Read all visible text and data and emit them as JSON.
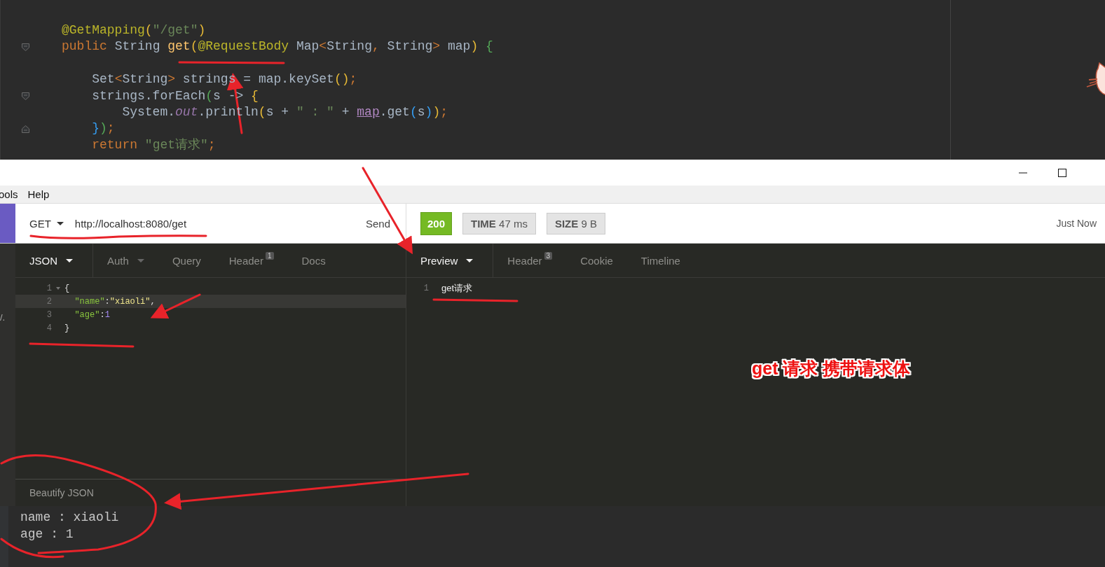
{
  "code_editor": {
    "lines": [
      {
        "kind": "code",
        "tokens": [
          {
            "text": "@GetMapping",
            "kind": "annotation"
          },
          {
            "text": "(",
            "kind": "bracket1"
          },
          {
            "text": "\"/get\"",
            "kind": "string"
          },
          {
            "text": ")",
            "kind": "bracket1"
          }
        ]
      },
      {
        "kind": "fold-start",
        "tokens": [
          {
            "text": "public ",
            "kind": "keyword"
          },
          {
            "text": "String ",
            "kind": "plain"
          },
          {
            "text": "get",
            "kind": "method"
          },
          {
            "text": "(",
            "kind": "bracket1"
          },
          {
            "text": "@RequestBody",
            "kind": "annotation"
          },
          {
            "text": " Map",
            "kind": "plain"
          },
          {
            "text": "<",
            "kind": "keyword"
          },
          {
            "text": "String",
            "kind": "plain"
          },
          {
            "text": ", ",
            "kind": "keyword"
          },
          {
            "text": "String",
            "kind": "plain"
          },
          {
            "text": ">",
            "kind": "keyword"
          },
          {
            "text": " map",
            "kind": "plain"
          },
          {
            "text": ")",
            "kind": "bracket1"
          },
          {
            "text": " {",
            "kind": "bracket2"
          }
        ]
      },
      {
        "kind": "blank"
      },
      {
        "kind": "code",
        "tokens": [
          {
            "text": "    Set",
            "kind": "plain"
          },
          {
            "text": "<",
            "kind": "keyword"
          },
          {
            "text": "String",
            "kind": "plain"
          },
          {
            "text": ">",
            "kind": "keyword"
          },
          {
            "text": " strings = map.keySet",
            "kind": "plain"
          },
          {
            "text": "()",
            "kind": "bracket1"
          },
          {
            "text": ";",
            "kind": "keyword"
          }
        ]
      },
      {
        "kind": "fold-start",
        "tokens": [
          {
            "text": "    strings.forEach",
            "kind": "plain"
          },
          {
            "text": "(",
            "kind": "bracket2"
          },
          {
            "text": "s -> ",
            "kind": "plain"
          },
          {
            "text": "{",
            "kind": "bracket1"
          }
        ]
      },
      {
        "kind": "code",
        "tokens": [
          {
            "text": "        System.",
            "kind": "plain"
          },
          {
            "text": "out",
            "kind": "field"
          },
          {
            "text": ".println",
            "kind": "plain"
          },
          {
            "text": "(",
            "kind": "bracket1"
          },
          {
            "text": "s + ",
            "kind": "plain"
          },
          {
            "text": "\" : \"",
            "kind": "string"
          },
          {
            "text": " + ",
            "kind": "plain"
          },
          {
            "text": "map",
            "kind": "link"
          },
          {
            "text": ".get",
            "kind": "plain"
          },
          {
            "text": "(",
            "kind": "bracket3"
          },
          {
            "text": "s",
            "kind": "plain"
          },
          {
            "text": ")",
            "kind": "bracket3"
          },
          {
            "text": ")",
            "kind": "bracket1"
          },
          {
            "text": ";",
            "kind": "keyword"
          }
        ]
      },
      {
        "kind": "fold-end",
        "tokens": [
          {
            "text": "    }",
            "kind": "bracket3"
          },
          {
            "text": ")",
            "kind": "bracket2"
          },
          {
            "text": ";",
            "kind": "keyword"
          }
        ]
      },
      {
        "kind": "code",
        "tokens": [
          {
            "text": "    return ",
            "kind": "keyword"
          },
          {
            "text": "\"get请求\"",
            "kind": "string"
          },
          {
            "text": ";",
            "kind": "keyword"
          }
        ]
      }
    ]
  },
  "menu_bar": {
    "items": [
      "ools",
      "Help"
    ]
  },
  "request": {
    "method": "GET",
    "url": "http://localhost:8080/get",
    "send": "Send"
  },
  "response": {
    "status": "200",
    "time_label": "TIME",
    "time": "47 ms",
    "size_label": "SIZE",
    "size": "9 B",
    "when": "Just Now"
  },
  "request_tabs": [
    {
      "label": "JSON",
      "dropdown": true,
      "selected": true
    },
    {
      "label": "Auth",
      "dropdown": true,
      "selected": false
    },
    {
      "label": "Query",
      "dropdown": false,
      "selected": false
    },
    {
      "label": "Header",
      "dropdown": false,
      "badge": "1",
      "selected": false
    },
    {
      "label": "Docs",
      "dropdown": false,
      "selected": false
    }
  ],
  "response_tabs": [
    {
      "label": "Preview",
      "dropdown": true,
      "selected": true
    },
    {
      "label": "Header",
      "dropdown": false,
      "badge": "3",
      "selected": false
    },
    {
      "label": "Cookie",
      "dropdown": false,
      "selected": false
    },
    {
      "label": "Timeline",
      "dropdown": false,
      "selected": false
    }
  ],
  "body_editor": {
    "lines": [
      {
        "number": "1",
        "foldable": true,
        "highlighted": false,
        "tokens": [
          {
            "text": "{",
            "kind": "plain"
          }
        ]
      },
      {
        "number": "2",
        "foldable": false,
        "highlighted": true,
        "tokens": [
          {
            "text": "  \"name\"",
            "kind": "key"
          },
          {
            "text": ":",
            "kind": "plain"
          },
          {
            "text": "\"xiaoli\"",
            "kind": "value"
          },
          {
            "text": ",",
            "kind": "plain"
          }
        ]
      },
      {
        "number": "3",
        "foldable": false,
        "highlighted": false,
        "tokens": [
          {
            "text": "  \"age\"",
            "kind": "key"
          },
          {
            "text": ":",
            "kind": "plain"
          },
          {
            "text": "1",
            "kind": "number"
          }
        ]
      },
      {
        "number": "4",
        "foldable": false,
        "highlighted": false,
        "tokens": [
          {
            "text": "}",
            "kind": "plain"
          }
        ]
      }
    ],
    "footer_button": "Beautify JSON"
  },
  "sidebar_fragment": "/.",
  "preview": {
    "lines": [
      {
        "number": "1",
        "text": "get请求"
      }
    ]
  },
  "annotation_text": "get 请求 携带请求体",
  "console": {
    "lines": [
      "name : xiaoli",
      "age : 1"
    ]
  }
}
